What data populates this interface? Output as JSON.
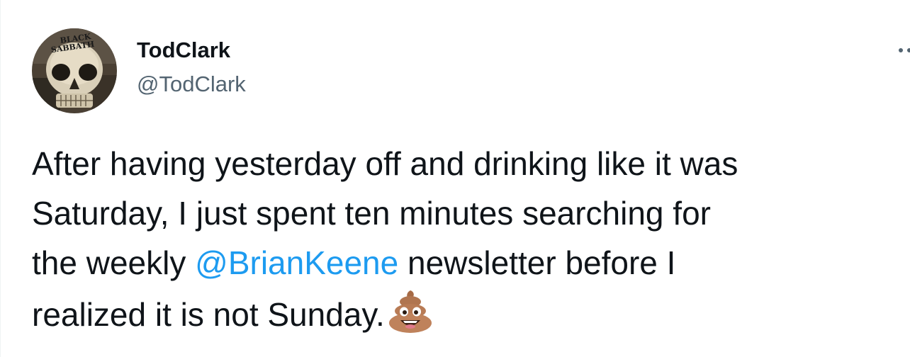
{
  "author": {
    "display_name": "TodClark",
    "handle": "@TodClark",
    "avatar_icon": "skull-album-art-icon",
    "avatar_lettering": [
      "BLACK",
      "SABBATH"
    ]
  },
  "more_icon": "more-dots-icon",
  "tweet": {
    "line1": "After having yesterday off and drinking like it was",
    "line2": "Saturday, I just spent ten minutes searching for",
    "line3_before": "the weekly ",
    "mention": "@BrianKeene",
    "line3_after": " newsletter before I",
    "line4": "realized it is not Sunday.",
    "emoji": "pile-of-poo-emoji"
  },
  "colors": {
    "text": "#0f1419",
    "secondary_text": "#536471",
    "link": "#1d9bf0",
    "background": "#ffffff"
  }
}
